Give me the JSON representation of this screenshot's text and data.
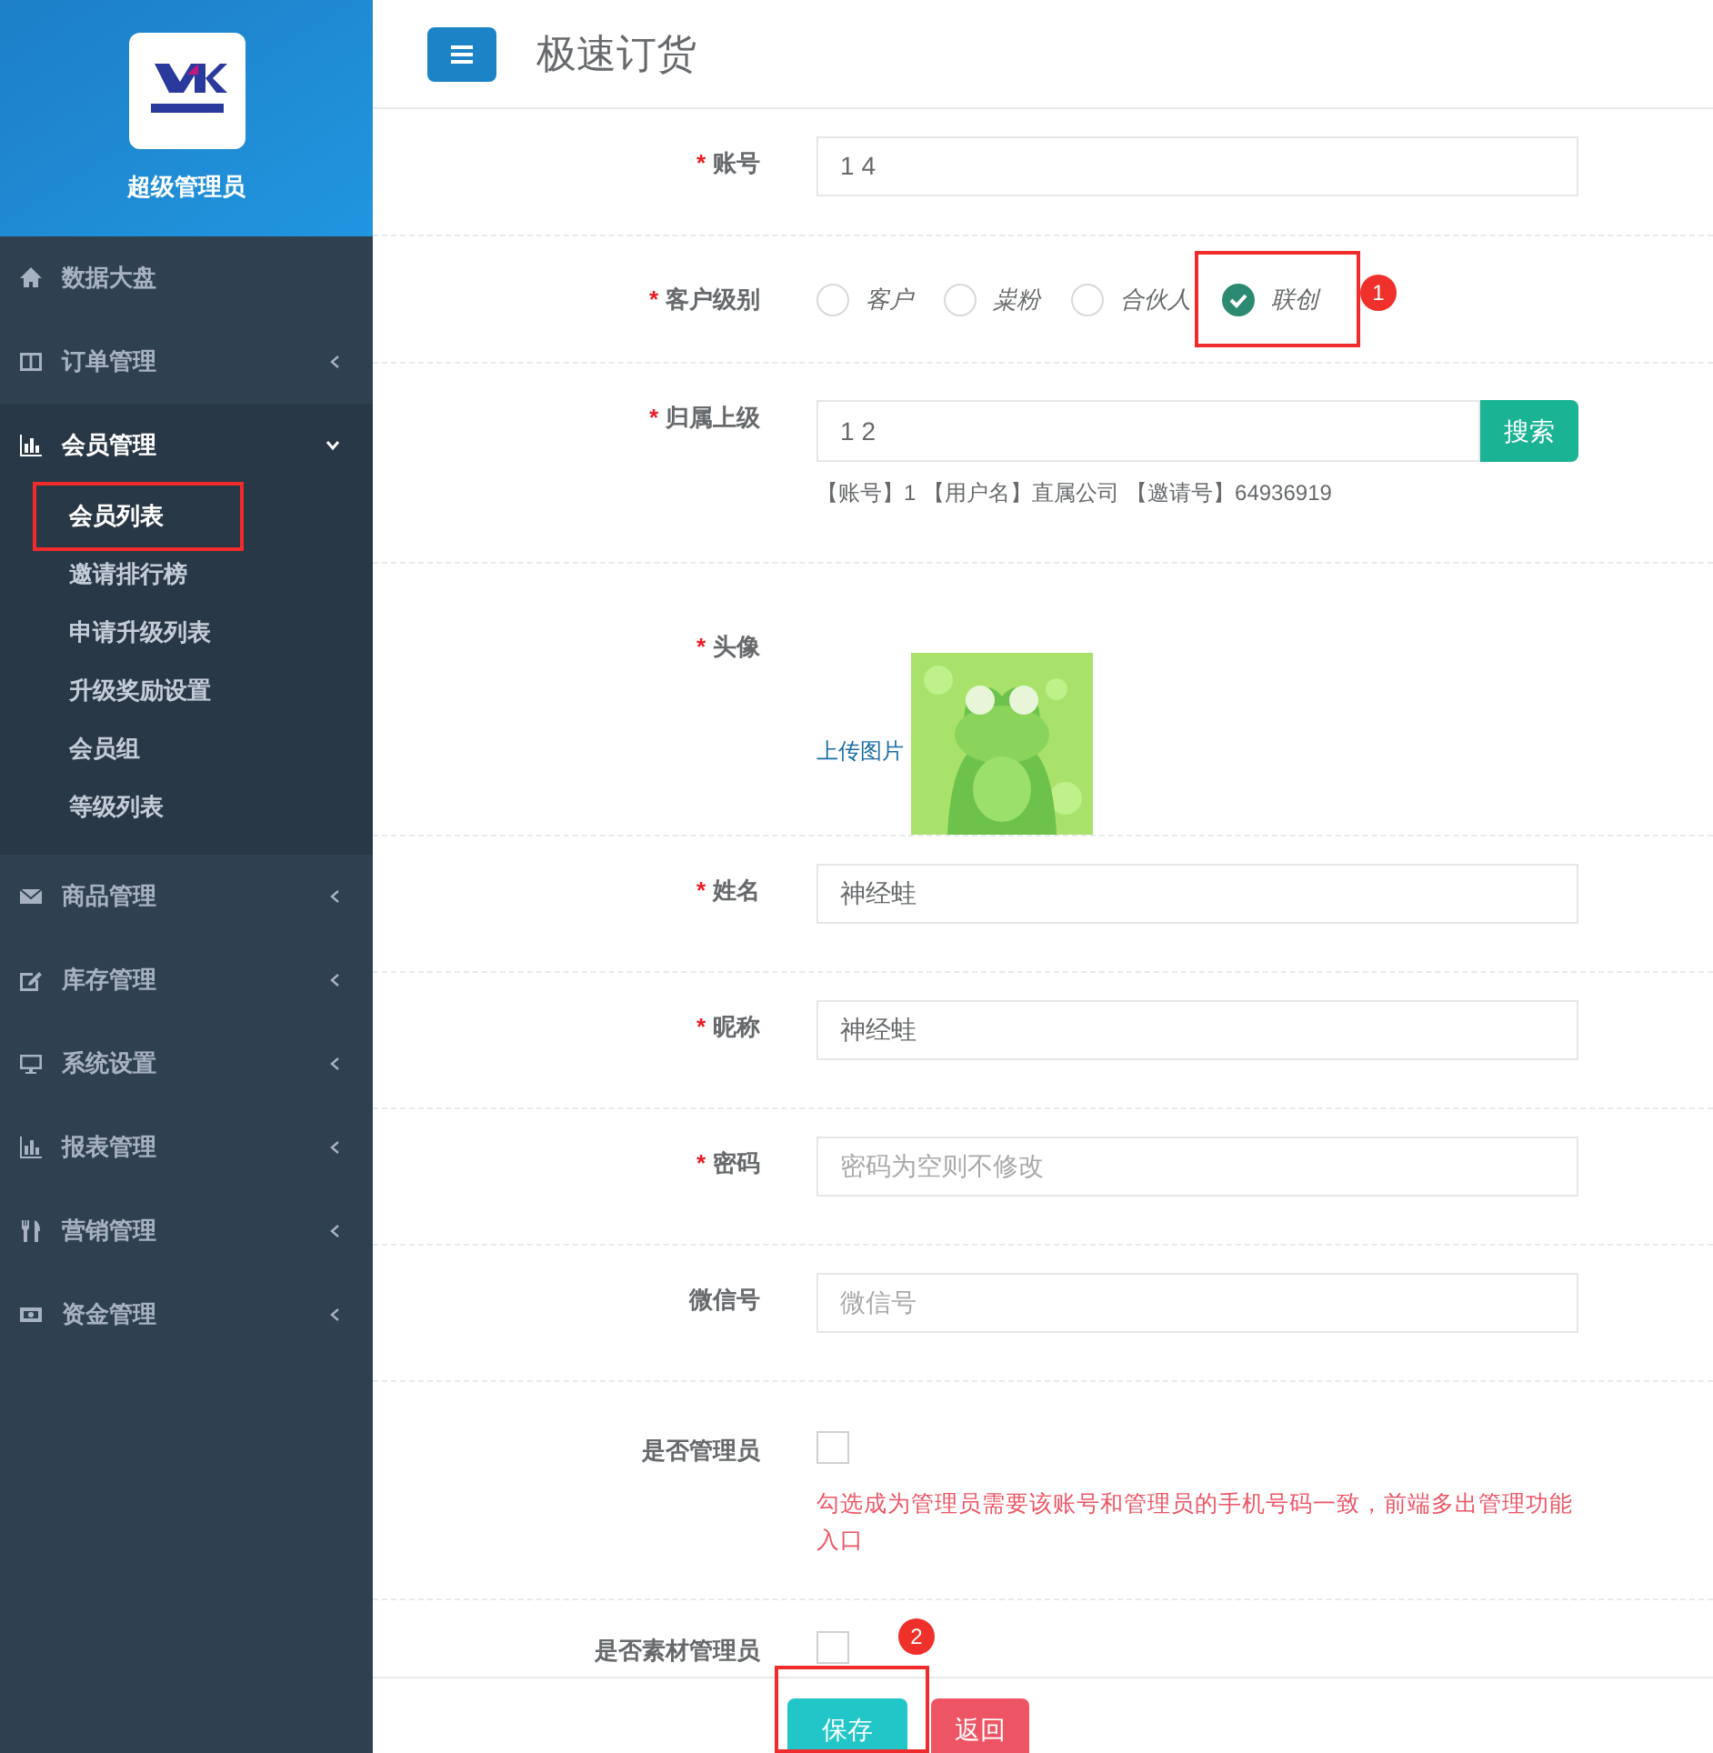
{
  "sidebar": {
    "profile_name": "超级管理员",
    "items": [
      {
        "label": "数据大盘",
        "kind": "link",
        "expanded": false
      },
      {
        "label": "订单管理",
        "kind": "group",
        "expanded": false
      },
      {
        "label": "会员管理",
        "kind": "group",
        "expanded": true,
        "children": [
          {
            "label": "会员列表",
            "selected": true
          },
          {
            "label": "邀请排行榜",
            "selected": false
          },
          {
            "label": "申请升级列表",
            "selected": false
          },
          {
            "label": "升级奖励设置",
            "selected": false
          },
          {
            "label": "会员组",
            "selected": false
          },
          {
            "label": "等级列表",
            "selected": false
          }
        ]
      },
      {
        "label": "商品管理",
        "kind": "group",
        "expanded": false
      },
      {
        "label": "库存管理",
        "kind": "group",
        "expanded": false
      },
      {
        "label": "系统设置",
        "kind": "group",
        "expanded": false
      },
      {
        "label": "报表管理",
        "kind": "group",
        "expanded": false
      },
      {
        "label": "营销管理",
        "kind": "group",
        "expanded": false
      },
      {
        "label": "资金管理",
        "kind": "group",
        "expanded": false
      }
    ]
  },
  "header": {
    "title": "极速订货"
  },
  "form": [
    {
      "kind": "text",
      "label": "账号",
      "marker": "*",
      "value_parts": [
        "1",
        "4"
      ]
    },
    {
      "kind": "radio",
      "label": "客户级别",
      "marker": "*",
      "options": [
        {
          "label": "客户",
          "selected": false
        },
        {
          "label": "粜粉",
          "selected": false
        },
        {
          "label": "合伙人",
          "selected": false
        },
        {
          "label": "联创",
          "selected": true
        }
      ]
    },
    {
      "kind": "search",
      "label": "归属上级",
      "marker": "*",
      "value_parts": [
        "1",
        "2"
      ],
      "button": "搜索",
      "info_parts": [
        "【账号】1",
        "【用户名】直属公司 【邀请号】64936919"
      ]
    },
    {
      "label": "头像",
      "marker": "*",
      "link": "上传图片"
    },
    {
      "kind": "text",
      "label": "姓名",
      "marker": "*",
      "value": "神经蛙"
    },
    {
      "kind": "text",
      "label": "昵称",
      "marker": "*",
      "value": "神经蛙"
    },
    {
      "kind": "text",
      "label": "密码",
      "marker": "*",
      "placeholder": "密码为空则不修改"
    },
    {
      "kind": "text",
      "label": "微信号",
      "placeholder": "微信号"
    },
    {
      "kind": "checkbox",
      "label": "是否管理员",
      "checked": false,
      "hint": "勾选成为管理员需要该账号和管理员的手机号码一致，前端多出管理功能入口"
    },
    {
      "kind": "checkbox",
      "label": "是否素材管理员",
      "checked": false
    }
  ],
  "footer": {
    "buttons": [
      {
        "label": "保存",
        "kind": "save"
      },
      {
        "label": "返回",
        "kind": "back"
      }
    ]
  },
  "annotations": [
    {
      "label": "1"
    },
    {
      "label": "2"
    }
  ]
}
